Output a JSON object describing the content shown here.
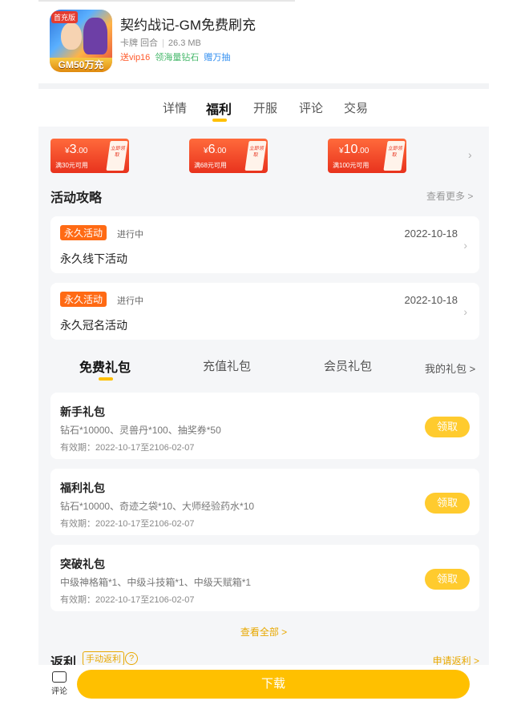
{
  "app": {
    "icon_badge": "首充版",
    "icon_banner": "GM50万充",
    "title": "契约战记-GM免费刷充",
    "category": "卡牌 回合",
    "size": "26.3 MB",
    "tags": [
      "送vip16",
      "领海量钻石",
      "赠万抽"
    ]
  },
  "tabs": [
    "详情",
    "福利",
    "开服",
    "评论",
    "交易"
  ],
  "active_tab": "福利",
  "coupons": [
    {
      "symbol": "¥",
      "int": "3",
      "dec": ".00",
      "condition": "满30元可用",
      "stub": "立即领取"
    },
    {
      "symbol": "¥",
      "int": "6",
      "dec": ".00",
      "condition": "满68元可用",
      "stub": "立即领取"
    },
    {
      "symbol": "¥",
      "int": "10",
      "dec": ".00",
      "condition": "满100元可用",
      "stub": "立即领取"
    }
  ],
  "activities": {
    "title": "活动攻略",
    "more": "查看更多 >",
    "items": [
      {
        "tag": "永久活动",
        "status": "进行中",
        "date": "2022-10-18",
        "name": "永久线下活动"
      },
      {
        "tag": "永久活动",
        "status": "进行中",
        "date": "2022-10-18",
        "name": "永久冠名活动"
      }
    ]
  },
  "gift_tabs": [
    "免费礼包",
    "充值礼包",
    "会员礼包"
  ],
  "my_gifts": "我的礼包 >",
  "gifts": [
    {
      "name": "新手礼包",
      "items": "钻石*10000、灵兽丹*100、抽奖券*50",
      "valid": "有效期：2022-10-17至2106-02-07",
      "action": "领取"
    },
    {
      "name": "福利礼包",
      "items": "钻石*10000、奇迹之袋*10、大师经验药水*10",
      "valid": "有效期：2022-10-17至2106-02-07",
      "action": "领取"
    },
    {
      "name": "突破礼包",
      "items": "中级神格箱*1、中级斗技箱*1、中级天赋箱*1",
      "valid": "有效期：2022-10-17至2106-02-07",
      "action": "领取"
    }
  ],
  "see_all": "查看全部 >",
  "rebate": {
    "title": "返利",
    "tag": "手动返利",
    "help": "?",
    "apply": "申请返利 >"
  },
  "bottom": {
    "comment": "评论",
    "download": "下载"
  },
  "colors": {
    "accent": "#ffc000",
    "coupon_red": "#e8321d",
    "activity_tag": "#ff6a14"
  }
}
